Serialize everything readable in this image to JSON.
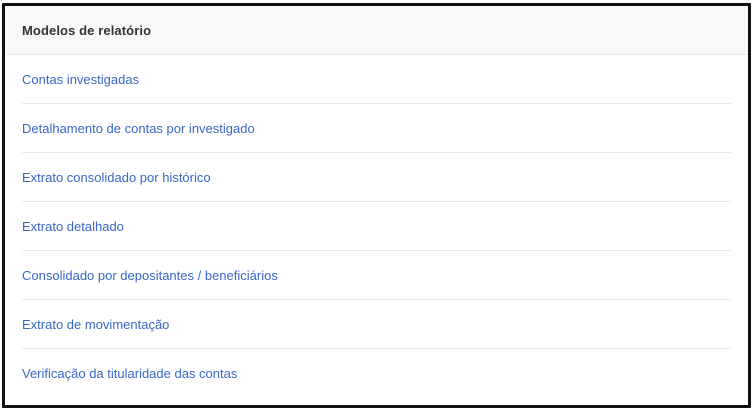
{
  "panel": {
    "title": "Modelos de relatório",
    "items": [
      {
        "label": "Contas investigadas"
      },
      {
        "label": "Detalhamento de contas por investigado"
      },
      {
        "label": "Extrato consolidado por histórico"
      },
      {
        "label": "Extrato detalhado"
      },
      {
        "label": "Consolidado por depositantes / beneficiários"
      },
      {
        "label": "Extrato de movimentação"
      },
      {
        "label": "Verificação da titularidade das contas"
      }
    ]
  },
  "colors": {
    "link": "#3867c8",
    "title": "#333333",
    "header_bg": "#f8f8f8",
    "border": "#111111"
  }
}
